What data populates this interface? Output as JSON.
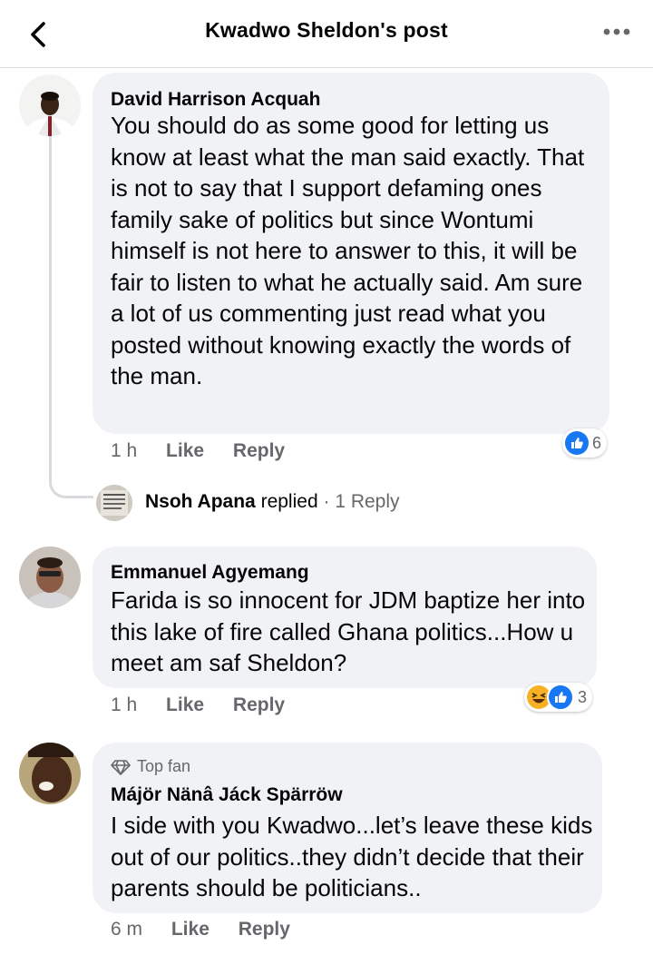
{
  "header": {
    "title": "Kwadwo Sheldon's post",
    "back_icon": "chevron-left-icon",
    "more_icon": "more-horizontal-icon"
  },
  "comments": [
    {
      "author": "David Harrison Acquah",
      "text": "You should do as some good for letting us know at least what the man said exactly. That is not to say that I support defaming ones family sake of politics but since Wontumi himself is not here to answer to this, it will be fair to listen to what he actually said. Am sure a lot of us commenting just read what you posted without knowing exactly the words of the man.",
      "time": "1 h",
      "like_label": "Like",
      "reply_label": "Reply",
      "reaction_count": "6",
      "replies_summary": {
        "replier": "Nsoh Apana",
        "verb": "replied",
        "separator": "·",
        "count_text": "1 Reply"
      }
    },
    {
      "author": "Emmanuel Agyemang",
      "text": "Farida is so innocent for JDM baptize her into this lake of fire called Ghana politics...How u meet am saf Sheldon?",
      "time": "1 h",
      "like_label": "Like",
      "reply_label": "Reply",
      "reaction_count": "3"
    },
    {
      "badge": "Top fan",
      "author": "Májör Nänâ Jáck Spärröw",
      "text": "I side with you Kwadwo...let’s leave these kids out of our politics..they didn’t decide that their parents should be politicians..",
      "time": "6 m",
      "like_label": "Like",
      "reply_label": "Reply"
    }
  ],
  "colors": {
    "bubble": "#f0f2f5",
    "meta_gray": "#65676b",
    "like_blue": "#1877f2",
    "haha_yellow": "#f7b125"
  }
}
